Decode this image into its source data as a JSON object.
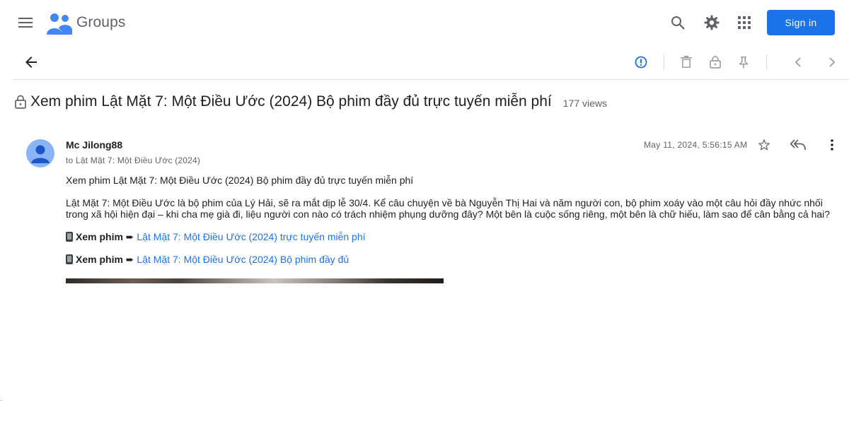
{
  "app": {
    "brand": "Groups"
  },
  "header": {
    "signin_label": "Sign in"
  },
  "thread": {
    "title": "Xem phim Lật Mặt 7: Một Điều Ước (2024) Bộ phim đầy đủ trực tuyến miễn phí",
    "views": "177 views"
  },
  "message": {
    "author": "Mc Jilong88",
    "to": "to Lật Mặt 7: Một Điều Ước (2024)",
    "date": "May 11, 2024, 5:56:15 AM",
    "paragraph1": "Xem phim Lật Mặt 7: Một Điều Ước (2024) Bộ phim đầy đủ trực tuyến miễn phí",
    "paragraph2": "Lật Mặt 7: Một Điều Ước là bộ phim của Lý Hải, sẽ ra mắt dịp lễ 30/4. Kể câu chuyện về bà Nguyễn Thị Hai và năm người con, bộ phim xoáy vào một câu hỏi đầy nhức nhối trong xã hội hiện đại – khi cha mẹ già đi, liệu người con nào có trách nhiệm phụng dưỡng đây? Một bên là cuộc sống riêng, một bên là chữ hiếu, làm sao để cân bằng cả hai?",
    "watch_label": "Xem phim",
    "arrow": "➨",
    "link1": "Lật Mặt 7: Một Điều Ước (2024) trực tuyến miễn phí",
    "link2": "Lật Mặt 7: Một Điều Ước (2024) Bộ phim đầy đủ"
  },
  "colors": {
    "accent": "#1a73e8",
    "text": "#202124",
    "muted": "#5f6368",
    "avatar": "#8ab4f8"
  },
  "icons": [
    "menu-icon",
    "groups-logo-icon",
    "search-icon",
    "gear-icon",
    "apps-grid-icon",
    "back-arrow-icon",
    "report-icon",
    "trash-icon",
    "lock-icon",
    "pin-icon",
    "chevron-left-icon",
    "chevron-right-icon",
    "title-lock-icon",
    "star-icon",
    "reply-all-icon",
    "more-vert-icon",
    "phone-icon"
  ]
}
